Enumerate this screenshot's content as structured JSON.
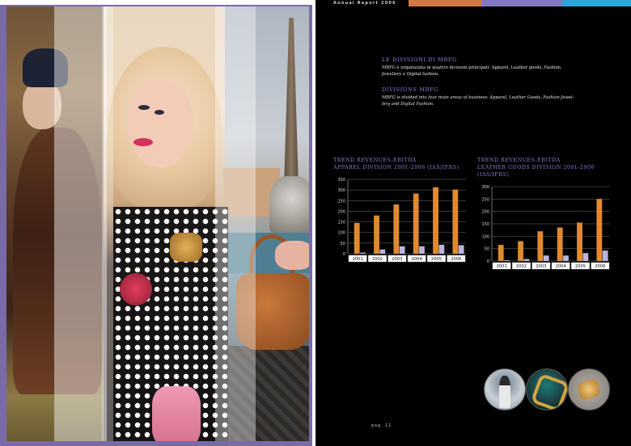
{
  "header": {
    "title": "Annual Report 2006",
    "bar_colors": [
      "#d27a46",
      "#8577c2",
      "#2aa7d8"
    ]
  },
  "sections": {
    "it_heading": "LE DIVISIONI DI MBFG",
    "it_text_line1": "MBFG è organizzata in quattro divisioni principali: Apparel, Leather goods, Fashion",
    "it_text_line2": "Jewellery e Digital fashion.",
    "en_heading": "DIVISIONS MBFG",
    "en_text_line1": "MBFG is divided into four main areas of business: Apparel, Leather Goods, Fashion Jewel-",
    "en_text_line2": "lery and Digital Fashion."
  },
  "charts": [
    {
      "title_line1": "TREND REVENUES-EBITDA",
      "title_line2": "APPAREL DIVISION 2001-2006 (IAS/IFRS)"
    },
    {
      "title_line1": "TREND REVENUES-EBITDA",
      "title_line2": "LEATHER GOODS DIVISION 2001-2006 (IAS/IFRS)"
    }
  ],
  "chart_data": [
    {
      "type": "bar",
      "title": "TREND REVENUES-EBITDA APPAREL DIVISION 2001-2006 (IAS/IFRS)",
      "categories": [
        "2001",
        "2002",
        "2003",
        "2004",
        "2005",
        "2006"
      ],
      "series": [
        {
          "values": [
            145,
            180,
            232,
            283,
            313,
            302
          ],
          "color": "#e18a2d"
        },
        {
          "values": [
            5,
            20,
            35,
            35,
            42,
            40
          ],
          "color": "#b9b4e0"
        }
      ],
      "yticks": [
        0,
        50,
        100,
        150,
        200,
        250,
        300,
        350
      ],
      "ylim": [
        0,
        350
      ],
      "grid": true
    },
    {
      "type": "bar",
      "title": "TREND REVENUES-EBITDA LEATHER GOODS DIVISION 2001-2006 (IAS/IFRS)",
      "categories": [
        "2001",
        "2002",
        "2003",
        "2004",
        "2005",
        "2006"
      ],
      "series": [
        {
          "values": [
            65,
            80,
            120,
            135,
            155,
            250
          ],
          "color": "#e18a2d"
        },
        {
          "values": [
            3,
            8,
            22,
            22,
            32,
            42
          ],
          "color": "#b9b4e0"
        }
      ],
      "yticks": [
        0,
        50,
        100,
        150,
        200,
        250,
        300
      ],
      "ylim": [
        0,
        300
      ],
      "grid": true
    }
  ],
  "footer": {
    "page_number": "pag. 11"
  }
}
